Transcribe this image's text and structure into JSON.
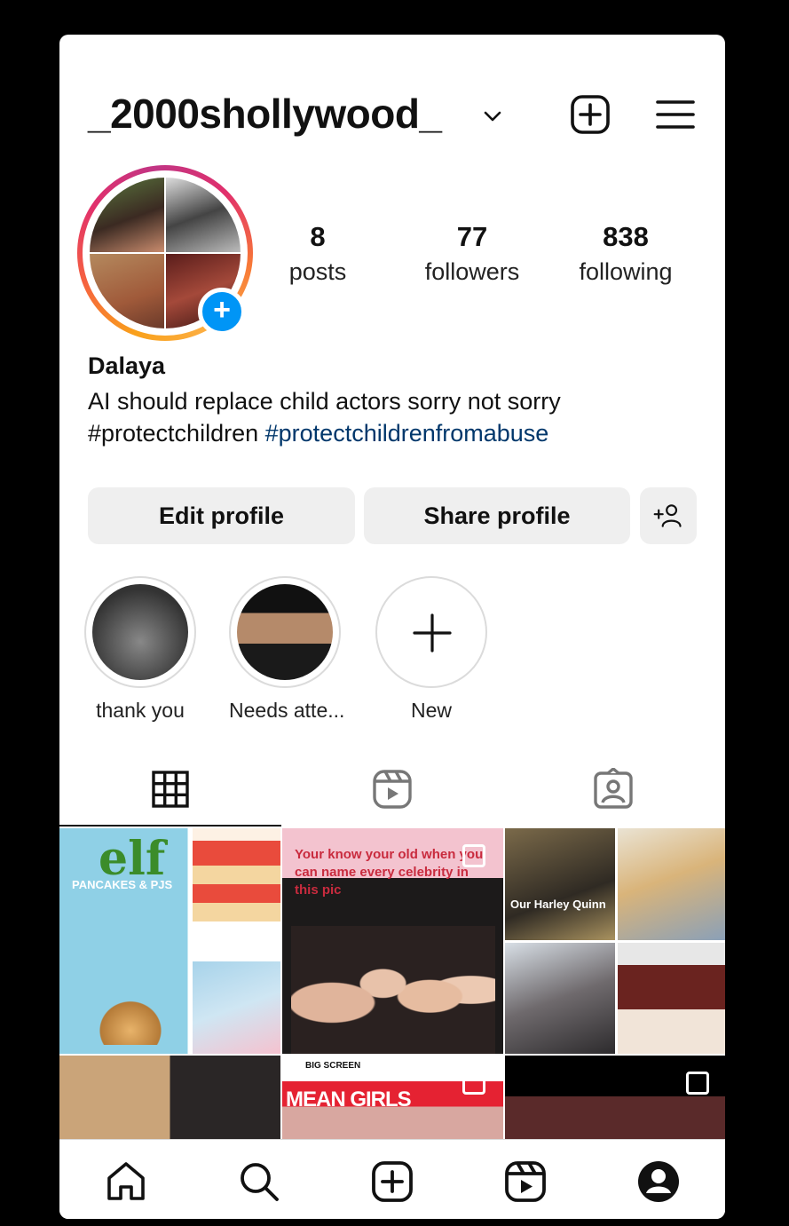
{
  "header": {
    "username": "_2000shollywood_"
  },
  "stats": {
    "posts_count": "8",
    "posts_label": "posts",
    "followers_count": "77",
    "followers_label": "followers",
    "following_count": "838",
    "following_label": "following"
  },
  "bio": {
    "name": "Dalaya",
    "line1": "AI should replace child actors sorry not sorry",
    "tag1": "#protectchildren",
    "tag2": "#protectchildrenfromabuse"
  },
  "buttons": {
    "edit": "Edit profile",
    "share": "Share profile"
  },
  "highlights": [
    {
      "label": "thank you"
    },
    {
      "label": "Needs atte..."
    },
    {
      "label": "New"
    }
  ],
  "posts": {
    "p1_title": "elf",
    "p1_sub": "PANCAKES & PJS",
    "p2_caption": "Your know your old when you can name every celebrity in this pic",
    "p3_caption": "Our Harley Quinn",
    "p5_title": "MEAN GIRLS",
    "p5_sub": "BIG SCREEN"
  },
  "colors": {
    "accent": "#0095f6",
    "hashtag": "#00376b",
    "button_bg": "#efefef"
  }
}
